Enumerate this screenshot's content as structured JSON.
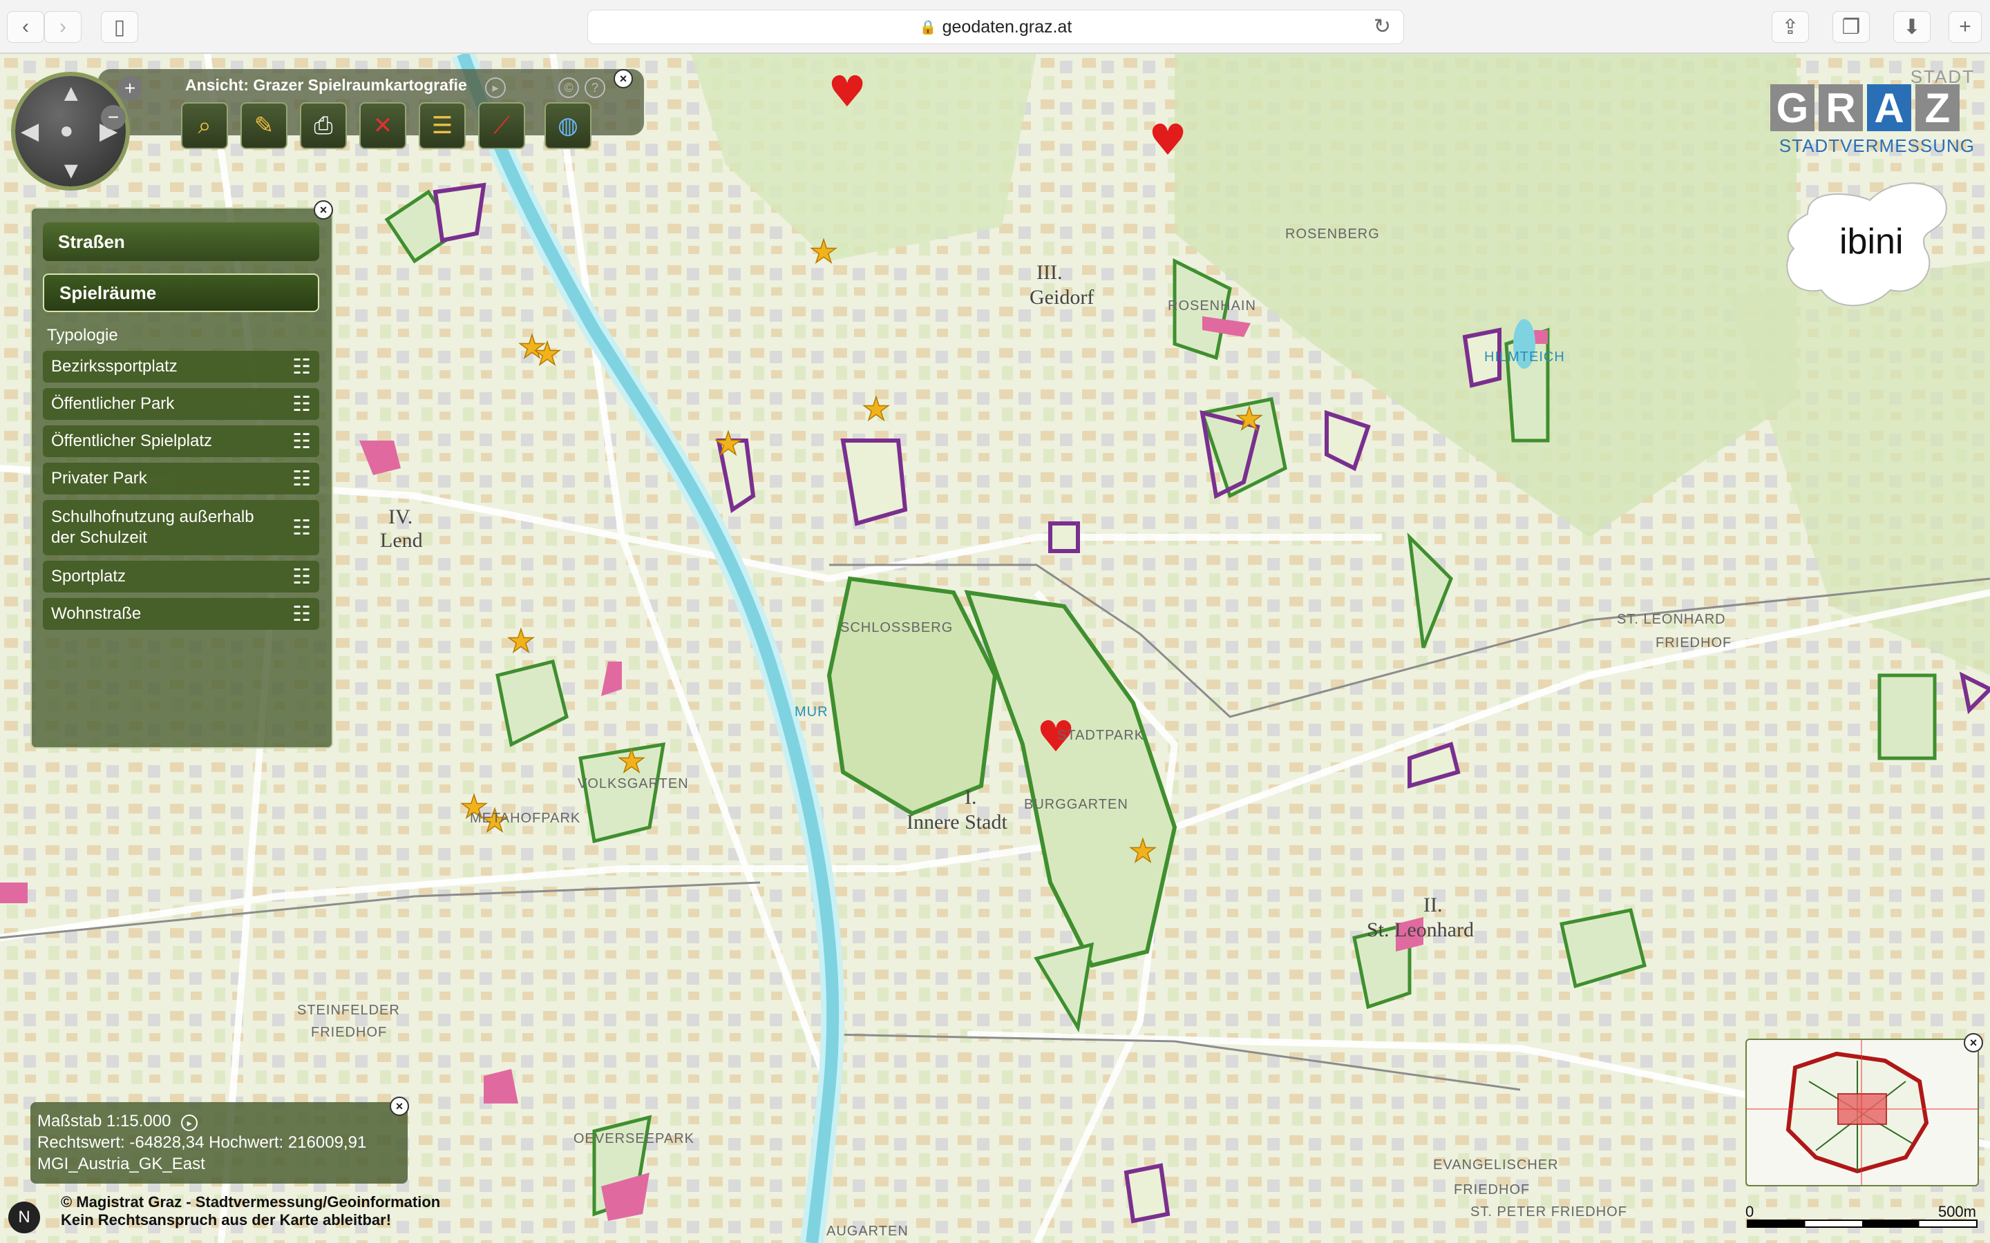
{
  "browser": {
    "url": "geodaten.graz.at",
    "back": "‹",
    "forward": "›"
  },
  "toolbar": {
    "title": "Ansicht: Grazer Spielraumkartografie"
  },
  "panel": {
    "cat_streets": "Straßen",
    "cat_play": "Spielräume",
    "typologie_label": "Typologie",
    "items": [
      {
        "label": "Bezirkssportplatz"
      },
      {
        "label": "Öffentlicher Park"
      },
      {
        "label": "Öffentlicher Spielplatz"
      },
      {
        "label": "Privater Park"
      },
      {
        "label": "Schulhofnutzung außerhalb der Schulzeit"
      },
      {
        "label": "Sportplatz"
      },
      {
        "label": "Wohnstraße"
      }
    ]
  },
  "info": {
    "scale": "Maßstab 1:15.000",
    "coords": "Rechtswert: -64828,34 Hochwert: 216009,91",
    "crs": "MGI_Austria_GK_East"
  },
  "copyright": {
    "line1": "© Magistrat Graz - Stadtvermessung/Geoinformation",
    "line2": "Kein Rechtsanspruch aus der Karte ableitbar!"
  },
  "logo": {
    "stadt": "STADT",
    "letters": [
      "G",
      "R",
      "A",
      "Z"
    ],
    "sub": "STADTVERMESSUNG",
    "ibini": "ibini"
  },
  "scale_bar": {
    "start": "0",
    "end": "500m"
  },
  "map_labels": {
    "geidorf_num": "III.",
    "geidorf": "Geidorf",
    "lend_num": "IV.",
    "lend": "Lend",
    "innere_num": "I.",
    "innere": "Innere Stadt",
    "leonhard_num": "II.",
    "leonhard": "St. Leonhard",
    "rosenberg": "ROSENBERG",
    "rosenhain": "ROSENHAIN",
    "hilmteich": "HILMTEICH",
    "schlossberg": "SCHLOSSBERG",
    "stadtpark": "STADTPARK",
    "burggarten": "BURGGARTEN",
    "steinfelder": "STEINFELDER",
    "friedhof": "FRIEDHOF",
    "leonhard_friedhof": "ST. LEONHARD",
    "evangelischer": "EVANGELISCHER",
    "peter_friedhof": "ST. PETER FRIEDHOF",
    "mur": "MUR",
    "augarten": "AUGARTEN",
    "volksgarten": "VOLKSGARTEN",
    "oeversee": "OEVERSEEPARK",
    "metahof": "METAHOFPARK"
  },
  "colors": {
    "park_green": "#3f8f2f",
    "play_purple": "#7a2f8f",
    "fill_pink": "#e06aa0",
    "river": "#7fd3e0",
    "star": "#f2b21b",
    "heart": "#e21b1b"
  }
}
